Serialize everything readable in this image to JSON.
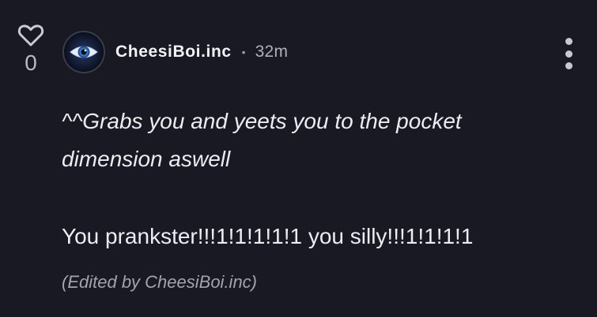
{
  "comment": {
    "like_icon": "heart-outline-icon",
    "like_count": "0",
    "avatar_icon": "eye-icon",
    "username": "CheesiBoi.inc",
    "separator": "•",
    "time_ago": "32m",
    "more_icon": "vertical-ellipsis-icon",
    "body_lines": [
      "^^Grabs you and yeets you to the pocket",
      "dimension aswell",
      "You prankster!!!1!1!1!1!1 you silly!!!1!1!1!1"
    ],
    "edited_note": "(Edited by CheesiBoi.inc)"
  },
  "colors": {
    "background": "#191923",
    "text": "#ececf1",
    "muted": "#a3a3ae"
  }
}
